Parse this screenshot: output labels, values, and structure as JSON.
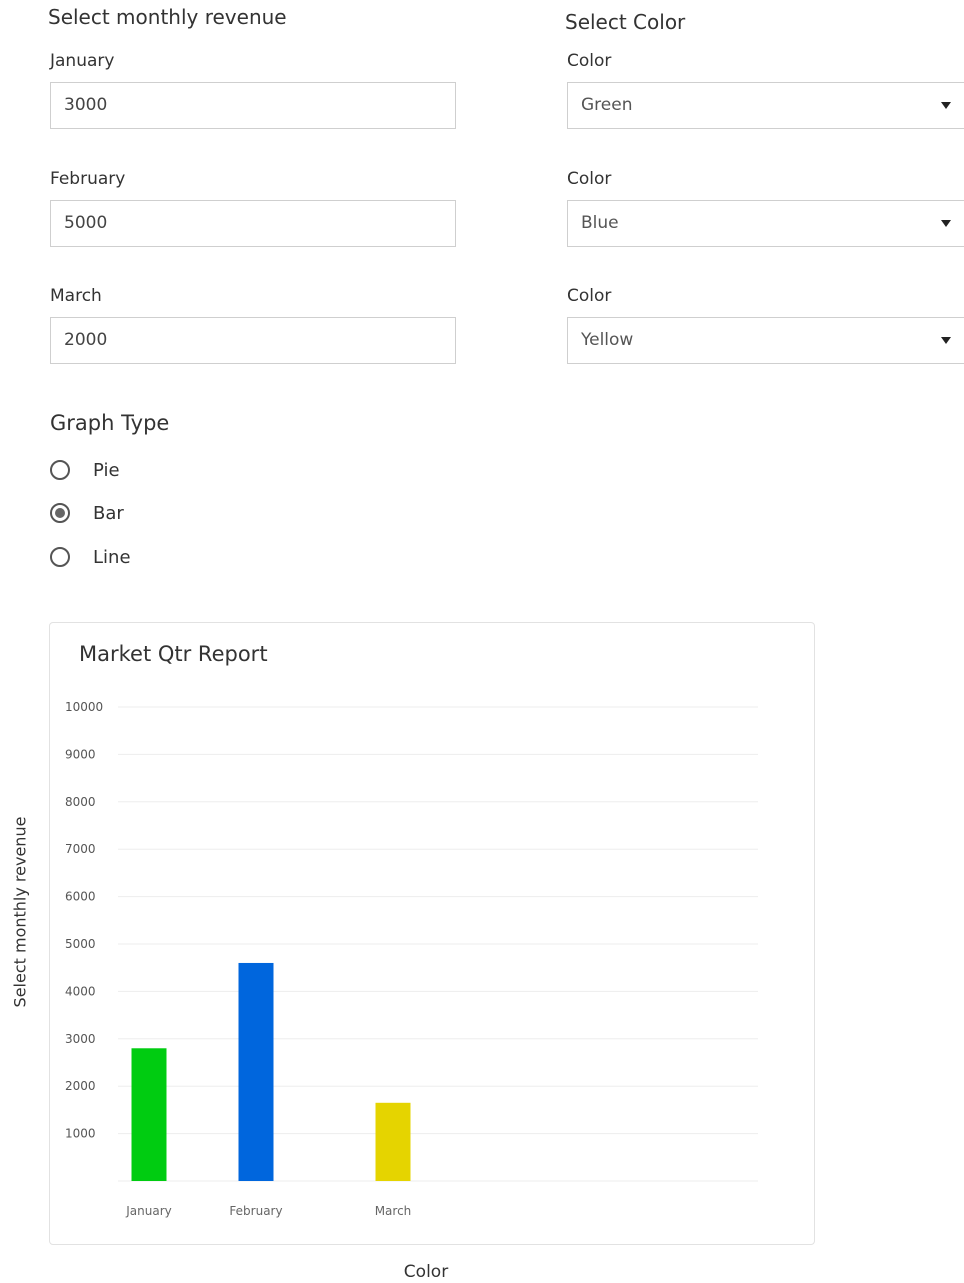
{
  "revenue_section": {
    "title": "Select monthly revenue",
    "fields": [
      {
        "label": "January",
        "value": "3000"
      },
      {
        "label": "February",
        "value": "5000"
      },
      {
        "label": "March",
        "value": "2000"
      }
    ]
  },
  "color_section": {
    "title": "Select Color",
    "fields": [
      {
        "label": "Color",
        "value": "Green"
      },
      {
        "label": "Color",
        "value": "Blue"
      },
      {
        "label": "Color",
        "value": "Yellow"
      }
    ]
  },
  "graph_type": {
    "title": "Graph Type",
    "options": [
      {
        "label": "Pie",
        "selected": false
      },
      {
        "label": "Bar",
        "selected": true
      },
      {
        "label": "Line",
        "selected": false
      }
    ]
  },
  "chart_data": {
    "type": "bar",
    "title": "Market Qtr Report",
    "ylabel": "Select monthly revenue",
    "xlabel": "Color",
    "categories": [
      "January",
      "February",
      "March"
    ],
    "values": [
      2800,
      4600,
      1650
    ],
    "colors": [
      "#00cc11",
      "#0066dd",
      "#e5d400"
    ],
    "ylim": [
      0,
      10000
    ],
    "yticks": [
      1000,
      2000,
      3000,
      4000,
      5000,
      6000,
      7000,
      8000,
      9000,
      10000
    ],
    "grid": true
  }
}
